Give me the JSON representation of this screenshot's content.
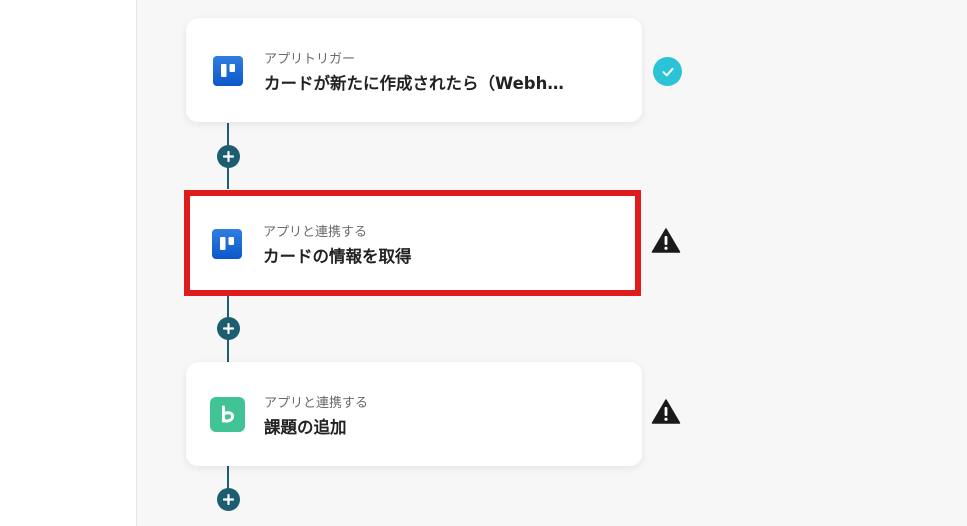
{
  "flow": {
    "steps": [
      {
        "type_label": "アプリトリガー",
        "title": "カードが新たに作成されたら（Webh…",
        "app_icon": "trello-icon",
        "status": "completed",
        "selected": false
      },
      {
        "type_label": "アプリと連携する",
        "title": "カードの情報を取得",
        "app_icon": "trello-icon",
        "status": "warning",
        "selected": true
      },
      {
        "type_label": "アプリと連携する",
        "title": "課題の追加",
        "app_icon": "backlog-icon",
        "status": "warning",
        "selected": false
      }
    ],
    "add_step_icon": "plus-icon"
  },
  "colors": {
    "connector": "#1d5d70",
    "completed": "#2bc3d6",
    "warning": "#1a1a1a",
    "selection_highlight": "#e01b1b",
    "trello": "#0c66e4",
    "backlog": "#42c396",
    "canvas": "#f7f7f7"
  }
}
